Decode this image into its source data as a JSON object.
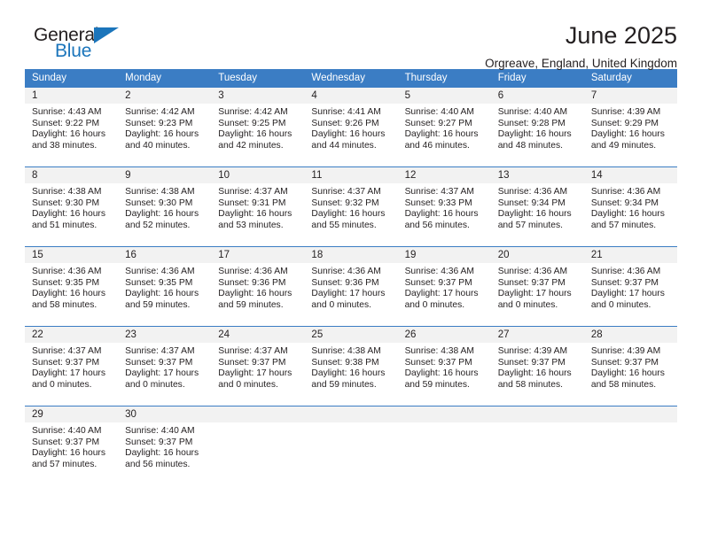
{
  "brand": {
    "name_top": "General",
    "name_bottom": "Blue",
    "accent_color": "#1b75bb"
  },
  "header": {
    "title": "June 2025",
    "location": "Orgreave, England, United Kingdom"
  },
  "theme": {
    "header_row_bg": "#3b7dc4",
    "daynum_band_bg": "#f2f2f2",
    "text_color": "#231f20"
  },
  "weekday_headers": [
    "Sunday",
    "Monday",
    "Tuesday",
    "Wednesday",
    "Thursday",
    "Friday",
    "Saturday"
  ],
  "weeks": [
    [
      {
        "day": "1",
        "sunrise": "Sunrise: 4:43 AM",
        "sunset": "Sunset: 9:22 PM",
        "daylight_1": "Daylight: 16 hours",
        "daylight_2": "and 38 minutes."
      },
      {
        "day": "2",
        "sunrise": "Sunrise: 4:42 AM",
        "sunset": "Sunset: 9:23 PM",
        "daylight_1": "Daylight: 16 hours",
        "daylight_2": "and 40 minutes."
      },
      {
        "day": "3",
        "sunrise": "Sunrise: 4:42 AM",
        "sunset": "Sunset: 9:25 PM",
        "daylight_1": "Daylight: 16 hours",
        "daylight_2": "and 42 minutes."
      },
      {
        "day": "4",
        "sunrise": "Sunrise: 4:41 AM",
        "sunset": "Sunset: 9:26 PM",
        "daylight_1": "Daylight: 16 hours",
        "daylight_2": "and 44 minutes."
      },
      {
        "day": "5",
        "sunrise": "Sunrise: 4:40 AM",
        "sunset": "Sunset: 9:27 PM",
        "daylight_1": "Daylight: 16 hours",
        "daylight_2": "and 46 minutes."
      },
      {
        "day": "6",
        "sunrise": "Sunrise: 4:40 AM",
        "sunset": "Sunset: 9:28 PM",
        "daylight_1": "Daylight: 16 hours",
        "daylight_2": "and 48 minutes."
      },
      {
        "day": "7",
        "sunrise": "Sunrise: 4:39 AM",
        "sunset": "Sunset: 9:29 PM",
        "daylight_1": "Daylight: 16 hours",
        "daylight_2": "and 49 minutes."
      }
    ],
    [
      {
        "day": "8",
        "sunrise": "Sunrise: 4:38 AM",
        "sunset": "Sunset: 9:30 PM",
        "daylight_1": "Daylight: 16 hours",
        "daylight_2": "and 51 minutes."
      },
      {
        "day": "9",
        "sunrise": "Sunrise: 4:38 AM",
        "sunset": "Sunset: 9:30 PM",
        "daylight_1": "Daylight: 16 hours",
        "daylight_2": "and 52 minutes."
      },
      {
        "day": "10",
        "sunrise": "Sunrise: 4:37 AM",
        "sunset": "Sunset: 9:31 PM",
        "daylight_1": "Daylight: 16 hours",
        "daylight_2": "and 53 minutes."
      },
      {
        "day": "11",
        "sunrise": "Sunrise: 4:37 AM",
        "sunset": "Sunset: 9:32 PM",
        "daylight_1": "Daylight: 16 hours",
        "daylight_2": "and 55 minutes."
      },
      {
        "day": "12",
        "sunrise": "Sunrise: 4:37 AM",
        "sunset": "Sunset: 9:33 PM",
        "daylight_1": "Daylight: 16 hours",
        "daylight_2": "and 56 minutes."
      },
      {
        "day": "13",
        "sunrise": "Sunrise: 4:36 AM",
        "sunset": "Sunset: 9:34 PM",
        "daylight_1": "Daylight: 16 hours",
        "daylight_2": "and 57 minutes."
      },
      {
        "day": "14",
        "sunrise": "Sunrise: 4:36 AM",
        "sunset": "Sunset: 9:34 PM",
        "daylight_1": "Daylight: 16 hours",
        "daylight_2": "and 57 minutes."
      }
    ],
    [
      {
        "day": "15",
        "sunrise": "Sunrise: 4:36 AM",
        "sunset": "Sunset: 9:35 PM",
        "daylight_1": "Daylight: 16 hours",
        "daylight_2": "and 58 minutes."
      },
      {
        "day": "16",
        "sunrise": "Sunrise: 4:36 AM",
        "sunset": "Sunset: 9:35 PM",
        "daylight_1": "Daylight: 16 hours",
        "daylight_2": "and 59 minutes."
      },
      {
        "day": "17",
        "sunrise": "Sunrise: 4:36 AM",
        "sunset": "Sunset: 9:36 PM",
        "daylight_1": "Daylight: 16 hours",
        "daylight_2": "and 59 minutes."
      },
      {
        "day": "18",
        "sunrise": "Sunrise: 4:36 AM",
        "sunset": "Sunset: 9:36 PM",
        "daylight_1": "Daylight: 17 hours",
        "daylight_2": "and 0 minutes."
      },
      {
        "day": "19",
        "sunrise": "Sunrise: 4:36 AM",
        "sunset": "Sunset: 9:37 PM",
        "daylight_1": "Daylight: 17 hours",
        "daylight_2": "and 0 minutes."
      },
      {
        "day": "20",
        "sunrise": "Sunrise: 4:36 AM",
        "sunset": "Sunset: 9:37 PM",
        "daylight_1": "Daylight: 17 hours",
        "daylight_2": "and 0 minutes."
      },
      {
        "day": "21",
        "sunrise": "Sunrise: 4:36 AM",
        "sunset": "Sunset: 9:37 PM",
        "daylight_1": "Daylight: 17 hours",
        "daylight_2": "and 0 minutes."
      }
    ],
    [
      {
        "day": "22",
        "sunrise": "Sunrise: 4:37 AM",
        "sunset": "Sunset: 9:37 PM",
        "daylight_1": "Daylight: 17 hours",
        "daylight_2": "and 0 minutes."
      },
      {
        "day": "23",
        "sunrise": "Sunrise: 4:37 AM",
        "sunset": "Sunset: 9:37 PM",
        "daylight_1": "Daylight: 17 hours",
        "daylight_2": "and 0 minutes."
      },
      {
        "day": "24",
        "sunrise": "Sunrise: 4:37 AM",
        "sunset": "Sunset: 9:37 PM",
        "daylight_1": "Daylight: 17 hours",
        "daylight_2": "and 0 minutes."
      },
      {
        "day": "25",
        "sunrise": "Sunrise: 4:38 AM",
        "sunset": "Sunset: 9:38 PM",
        "daylight_1": "Daylight: 16 hours",
        "daylight_2": "and 59 minutes."
      },
      {
        "day": "26",
        "sunrise": "Sunrise: 4:38 AM",
        "sunset": "Sunset: 9:37 PM",
        "daylight_1": "Daylight: 16 hours",
        "daylight_2": "and 59 minutes."
      },
      {
        "day": "27",
        "sunrise": "Sunrise: 4:39 AM",
        "sunset": "Sunset: 9:37 PM",
        "daylight_1": "Daylight: 16 hours",
        "daylight_2": "and 58 minutes."
      },
      {
        "day": "28",
        "sunrise": "Sunrise: 4:39 AM",
        "sunset": "Sunset: 9:37 PM",
        "daylight_1": "Daylight: 16 hours",
        "daylight_2": "and 58 minutes."
      }
    ],
    [
      {
        "day": "29",
        "sunrise": "Sunrise: 4:40 AM",
        "sunset": "Sunset: 9:37 PM",
        "daylight_1": "Daylight: 16 hours",
        "daylight_2": "and 57 minutes."
      },
      {
        "day": "30",
        "sunrise": "Sunrise: 4:40 AM",
        "sunset": "Sunset: 9:37 PM",
        "daylight_1": "Daylight: 16 hours",
        "daylight_2": "and 56 minutes."
      },
      {
        "day": "",
        "sunrise": "",
        "sunset": "",
        "daylight_1": "",
        "daylight_2": ""
      },
      {
        "day": "",
        "sunrise": "",
        "sunset": "",
        "daylight_1": "",
        "daylight_2": ""
      },
      {
        "day": "",
        "sunrise": "",
        "sunset": "",
        "daylight_1": "",
        "daylight_2": ""
      },
      {
        "day": "",
        "sunrise": "",
        "sunset": "",
        "daylight_1": "",
        "daylight_2": ""
      },
      {
        "day": "",
        "sunrise": "",
        "sunset": "",
        "daylight_1": "",
        "daylight_2": ""
      }
    ]
  ]
}
